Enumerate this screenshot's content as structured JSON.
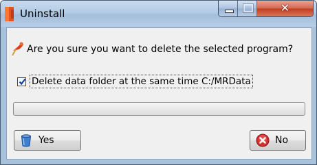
{
  "window": {
    "title": "Uninstall",
    "controls": {
      "minimize": "minimize",
      "maximize": "maximize",
      "close": "close"
    }
  },
  "dialog": {
    "question": "Are you sure you want to delete the selected program?",
    "checkbox": {
      "label": "Delete data folder at the same time C:/MRData",
      "checked": true
    },
    "progress": {
      "value": 0
    },
    "buttons": {
      "yes": "Yes",
      "no": "No"
    }
  },
  "icons": {
    "app": "app-icon",
    "question": "pushpin-icon",
    "yes": "recycle-bin-icon",
    "no": "cancel-x-icon"
  },
  "colors": {
    "title_bar": "#b3cbe5",
    "close_button": "#c23d1f",
    "dialog_bg": "#f0f0f0",
    "no_icon": "#d32f2f"
  }
}
